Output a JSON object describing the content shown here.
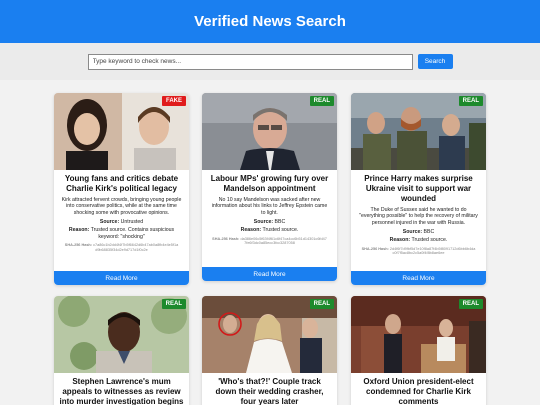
{
  "header": {
    "title": "Verified News Search"
  },
  "search": {
    "placeholder": "Type keyword to check news...",
    "button_label": "Search"
  },
  "labels": {
    "source": "Source:",
    "reason": "Reason:",
    "hash": "SHA-256 Hash:",
    "read_more": "Read More"
  },
  "articles": [
    {
      "badge": "FAKE",
      "title": "Young fans and critics debate Charlie Kirk's political legacy",
      "description": "Kirk attracted fervent crowds, bringing young people into conservative politics, while at the same time shocking some with provocative opinions.",
      "source": "Untrusted",
      "reason": "Trusted source. Contains suspicious keyword: \"shocking\"",
      "hash": "c7a86c1b2dd4f4f7b5f6642d6b47ab0a8fb4e4e5f1ad9b68835f34d2e9d717d1f0c2e"
    },
    {
      "badge": "REAL",
      "title": "Labour MPs' growing fury over Mandelson appointment",
      "description": "No 10 say Mandelson was sacked after new information about his links to Jeffrey Epstein came to light.",
      "source": "BBC",
      "reason": "Trusted source.",
      "hash": "da386e06c5f63f4f61c6f47ca4cc6b51d14301c6fd477fe6f3dc0a85ecc3fcc3287058"
    },
    {
      "badge": "REAL",
      "title": "Prince Harry makes surprise Ukraine visit to support war wounded",
      "description": "The Duke of Sussex said he wanted to do \"everything possible\" to help the recovery of military personnel injured in the war with Russia.",
      "source": "BBC",
      "reason": "Trusted source.",
      "hash": "2d4f6f7d9fbf5d7e10f8a87f4b5f8091712d6bb6b4dac0f7f5ac8bc2c5a0f4f8b8ae6ee"
    },
    {
      "badge": "REAL",
      "title": "Stephen Lawrence's mum appeals to witnesses as review into murder investigation begins"
    },
    {
      "badge": "REAL",
      "title": "'Who's that?!' Couple track down their wedding crasher, four years later"
    },
    {
      "badge": "REAL",
      "title": "Oxford Union president-elect condemned for Charlie Kirk comments"
    }
  ]
}
